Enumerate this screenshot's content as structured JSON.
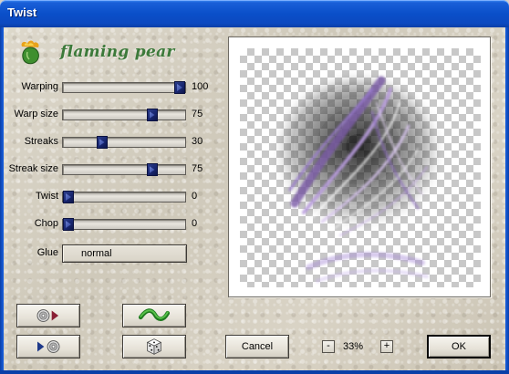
{
  "window": {
    "title": "Twist"
  },
  "brand": {
    "name": "flaming pear",
    "color": "#3c7a3a"
  },
  "sliders": [
    {
      "label": "Warping",
      "value": "100",
      "level": 1.0
    },
    {
      "label": "Warp size",
      "value": "75",
      "level": 0.75
    },
    {
      "label": "Streaks",
      "value": "30",
      "level": 0.3
    },
    {
      "label": "Streak size",
      "value": "75",
      "level": 0.75
    },
    {
      "label": "Twist",
      "value": "0",
      "level": 0.0
    },
    {
      "label": "Chop",
      "value": "0",
      "level": 0.0
    }
  ],
  "glue": {
    "label": "Glue",
    "value": "normal"
  },
  "buttons": {
    "load_preset_icon": "disc-arrow-load-icon",
    "save_preset_icon": "arrow-disc-save-icon",
    "wave_icon": "green-wave-icon",
    "random_icon": "dice-icon",
    "cancel": "Cancel",
    "ok": "OK"
  },
  "zoom": {
    "minus": "-",
    "plus": "+",
    "level": "33%"
  },
  "colors": {
    "titlebar": "#0a4fc9",
    "thumb": "#182670",
    "preview_tint": "#a07ad0"
  }
}
